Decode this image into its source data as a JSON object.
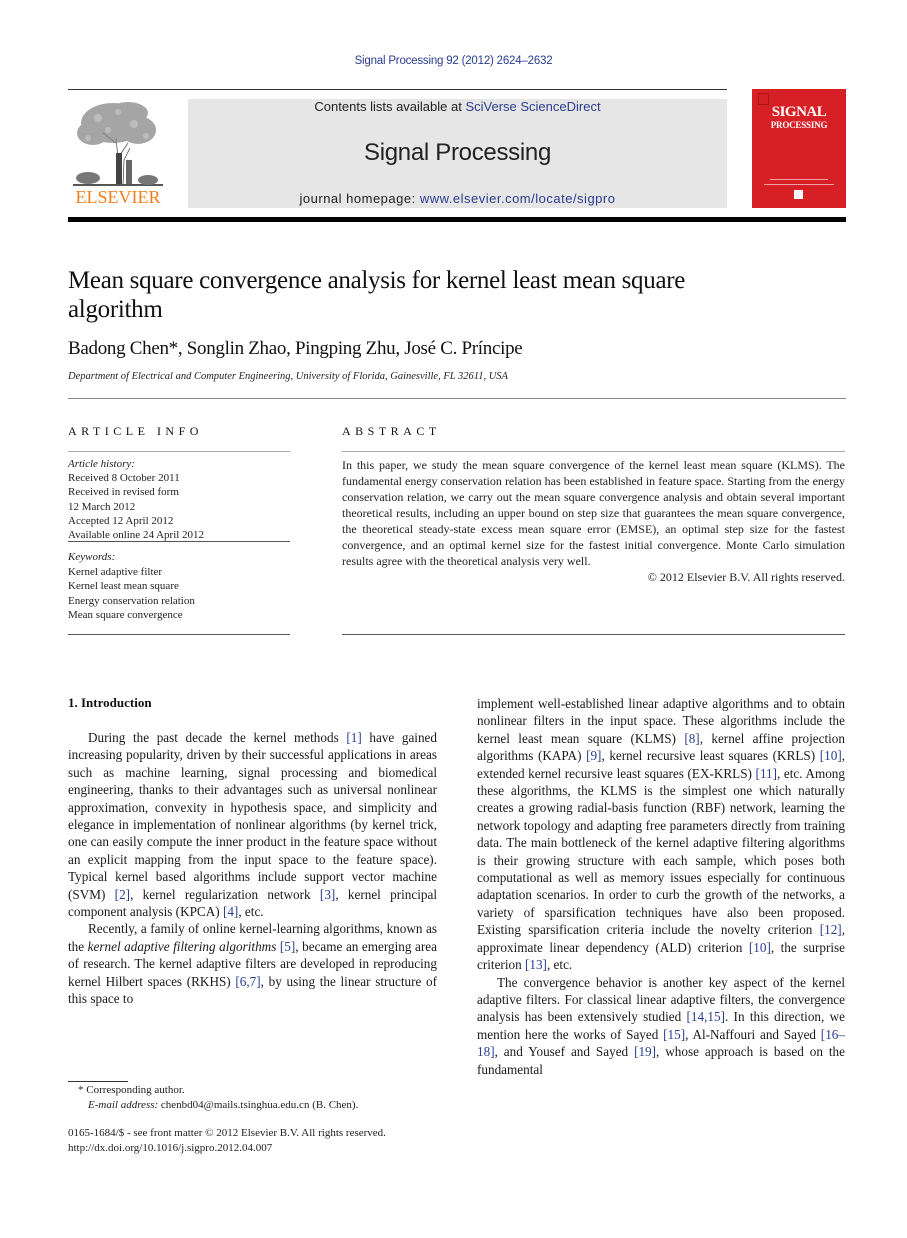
{
  "header": {
    "journal_ref": "Signal Processing 92 (2012) 2624–2632",
    "contents_prefix": "Contents lists available at ",
    "contents_link": "SciVerse ScienceDirect",
    "journal_name": "Signal Processing",
    "homepage_prefix": "journal homepage: ",
    "homepage_link": "www.elsevier.com/locate/sigpro",
    "publisher_logo_text": "ELSEVIER",
    "cover_title": "SIGNAL",
    "cover_subtitle": "PROCESSING",
    "colors": {
      "link": "#2a3d8f",
      "elsevier_orange": "#f07e19",
      "cover_red": "#d71f26",
      "masthead_gray": "#e6e6e6"
    }
  },
  "article": {
    "title": "Mean square convergence analysis for kernel least mean square algorithm",
    "authors": "Badong Chen*, Songlin Zhao, Pingping Zhu, José C. Príncipe",
    "affiliation": "Department of Electrical and Computer Engineering, University of Florida, Gainesville, FL 32611, USA"
  },
  "article_info": {
    "heading": "Article Info",
    "history_label": "Article history:",
    "history": [
      "Received 8 October 2011",
      "Received in revised form",
      "12 March 2012",
      "Accepted 12 April 2012",
      "Available online 24 April 2012"
    ],
    "keywords_label": "Keywords:",
    "keywords": [
      "Kernel adaptive filter",
      "Kernel least mean square",
      "Energy conservation relation",
      "Mean square convergence"
    ]
  },
  "abstract": {
    "heading": "Abstract",
    "text": "In this paper, we study the mean square convergence of the kernel least mean square (KLMS). The fundamental energy conservation relation has been established in feature space. Starting from the energy conservation relation, we carry out the mean square convergence analysis and obtain several important theoretical results, including an upper bound on step size that guarantees the mean square convergence, the theoretical steady-state excess mean square error (EMSE), an optimal step size for the fastest convergence, and an optimal kernel size for the fastest initial convergence. Monte Carlo simulation results agree with the theoretical analysis very well.",
    "copyright": "© 2012 Elsevier B.V. All rights reserved."
  },
  "body": {
    "section_heading": "1.  Introduction",
    "left_p1": [
      {
        "t": "During the past decade the kernel methods "
      },
      {
        "r": "[1]"
      },
      {
        "t": " have gained increasing popularity, driven by their successful applications in areas such as machine learning, signal processing and biomedical engineering, thanks to their advantages such as universal nonlinear approximation, convexity in hypothesis space, and simplicity and elegance in implementation of nonlinear algorithms (by kernel trick, one can easily compute the inner product in the feature space without an explicit mapping from the input space to the feature space). Typical kernel based algorithms include support vector machine (SVM) "
      },
      {
        "r": "[2]"
      },
      {
        "t": ", kernel regularization network "
      },
      {
        "r": "[3]"
      },
      {
        "t": ", kernel principal component analysis (KPCA) "
      },
      {
        "r": "[4]"
      },
      {
        "t": ", etc."
      }
    ],
    "left_p2": [
      {
        "t": "Recently, a family of online kernel-learning algorithms, known as the "
      },
      {
        "i": "kernel adaptive filtering algorithms"
      },
      {
        "t": " "
      },
      {
        "r": "[5]"
      },
      {
        "t": ", became an emerging area of research. The kernel adaptive filters are developed in reproducing kernel Hilbert spaces (RKHS) "
      },
      {
        "r": "[6,7]"
      },
      {
        "t": ", by using the linear structure of this space to"
      }
    ],
    "right_p1": [
      {
        "t": "implement well-established linear adaptive algorithms and to obtain nonlinear filters in the input space. These algorithms include the kernel least mean square (KLMS) "
      },
      {
        "r": "[8]"
      },
      {
        "t": ", kernel affine projection algorithms (KAPA) "
      },
      {
        "r": "[9]"
      },
      {
        "t": ", kernel recursive least squares (KRLS) "
      },
      {
        "r": "[10]"
      },
      {
        "t": ", extended kernel recursive least squares (EX-KRLS) "
      },
      {
        "r": "[11]"
      },
      {
        "t": ", etc. Among these algorithms, the KLMS is the simplest one which naturally creates a growing radial-basis function (RBF) network, learning the network topology and adapting free parameters directly from training data. The main bottleneck of the kernel adaptive filtering algorithms is their growing structure with each sample, which poses both computational as well as memory issues especially for continuous adaptation scenarios. In order to curb the growth of the networks, a variety of sparsification techniques have also been proposed. Existing sparsification criteria include the novelty criterion "
      },
      {
        "r": "[12]"
      },
      {
        "t": ", approximate linear dependency (ALD) criterion "
      },
      {
        "r": "[10]"
      },
      {
        "t": ", the surprise criterion "
      },
      {
        "r": "[13]"
      },
      {
        "t": ", etc."
      }
    ],
    "right_p2": [
      {
        "t": "The convergence behavior is another key aspect of the kernel adaptive filters. For classical linear adaptive filters, the convergence analysis has been extensively studied "
      },
      {
        "r": "[14,15]"
      },
      {
        "t": ". In this direction, we mention here the works of Sayed "
      },
      {
        "r": "[15]"
      },
      {
        "t": ", Al-Naffouri and Sayed "
      },
      {
        "r": "[16–18]"
      },
      {
        "t": ", and Yousef and Sayed "
      },
      {
        "r": "[19]"
      },
      {
        "t": ", whose approach is based on the fundamental"
      }
    ]
  },
  "footnote": {
    "corresponding": "* Corresponding author.",
    "email_label": "E-mail address:",
    "email": " chenbd04@mails.tsinghua.edu.cn (B. Chen)."
  },
  "issn": {
    "line1": "0165-1684/$ - see front matter © 2012 Elsevier B.V. All rights reserved.",
    "doi": "http://dx.doi.org/10.1016/j.sigpro.2012.04.007"
  }
}
